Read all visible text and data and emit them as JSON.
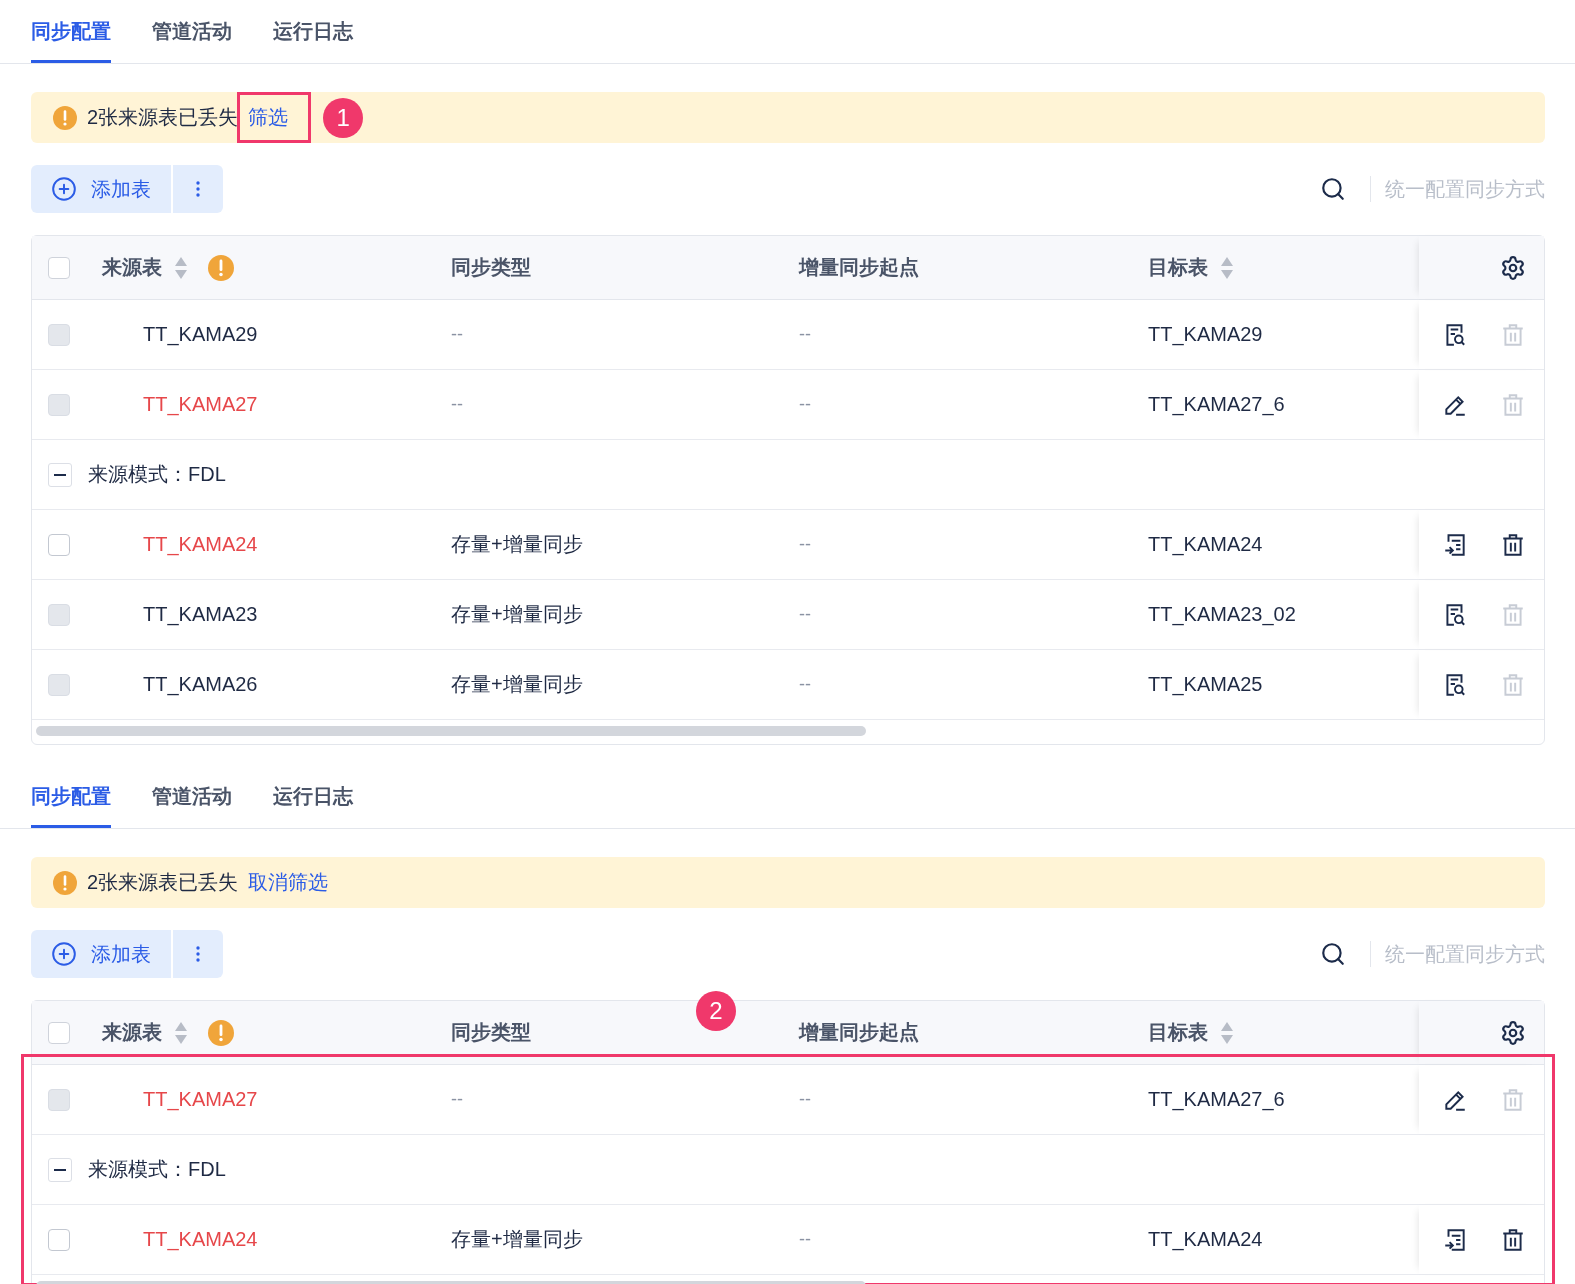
{
  "panels": [
    {
      "tabs": [
        {
          "label": "同步配置",
          "selected": true
        },
        {
          "label": "管道活动",
          "selected": false
        },
        {
          "label": "运行日志",
          "selected": false
        }
      ],
      "alert": {
        "message": "2张来源表已丢失",
        "action": "筛选",
        "action_highlighted": true,
        "badge": "1"
      },
      "toolbar": {
        "add_label": "添加表",
        "batch_label": "统一配置同步方式"
      },
      "table": {
        "highlighted": false,
        "all_selected": false,
        "columns": [
          {
            "label": "来源表",
            "sortable": true,
            "warning": true
          },
          {
            "label": "同步类型",
            "sortable": false,
            "warning": false
          },
          {
            "label": "增量同步起点",
            "sortable": false,
            "warning": false
          },
          {
            "label": "目标表",
            "sortable": true,
            "warning": false
          }
        ],
        "rows": [
          {
            "kind": "table",
            "source": "TT_KAMA29",
            "missing": false,
            "disabled": true,
            "sync_type": "--",
            "start": "--",
            "target": "TT_KAMA29",
            "action": {
              "kind": "view"
            },
            "deletable": false
          },
          {
            "kind": "table",
            "source": "TT_KAMA27",
            "missing": true,
            "disabled": true,
            "sync_type": "--",
            "start": "--",
            "target": "TT_KAMA27_6",
            "action": {
              "kind": "edit"
            },
            "deletable": false
          },
          {
            "kind": "group",
            "label": "来源模式：FDL",
            "expanded": true
          },
          {
            "kind": "table",
            "source": "TT_KAMA24",
            "missing": true,
            "disabled": false,
            "sync_type": "存量+增量同步",
            "start": "--",
            "target": "TT_KAMA24",
            "action": {
              "kind": "map"
            },
            "deletable": true
          },
          {
            "kind": "table",
            "source": "TT_KAMA23",
            "missing": false,
            "disabled": true,
            "sync_type": "存量+增量同步",
            "start": "--",
            "target": "TT_KAMA23_02",
            "action": {
              "kind": "view"
            },
            "deletable": false
          },
          {
            "kind": "table",
            "source": "TT_KAMA26",
            "missing": false,
            "disabled": true,
            "sync_type": "存量+增量同步",
            "start": "--",
            "target": "TT_KAMA25",
            "action": {
              "kind": "view"
            },
            "deletable": false
          }
        ]
      }
    },
    {
      "tabs": [
        {
          "label": "同步配置",
          "selected": true
        },
        {
          "label": "管道活动",
          "selected": false
        },
        {
          "label": "运行日志",
          "selected": false
        }
      ],
      "alert": {
        "message": "2张来源表已丢失",
        "action": "取消筛选",
        "action_highlighted": false
      },
      "toolbar": {
        "add_label": "添加表",
        "batch_label": "统一配置同步方式"
      },
      "table": {
        "highlighted": true,
        "all_selected": false,
        "badge": "2",
        "columns": [
          {
            "label": "来源表",
            "sortable": true,
            "warning": true
          },
          {
            "label": "同步类型",
            "sortable": false,
            "warning": false
          },
          {
            "label": "增量同步起点",
            "sortable": false,
            "warning": false
          },
          {
            "label": "目标表",
            "sortable": true,
            "warning": false
          }
        ],
        "rows": [
          {
            "kind": "table",
            "source": "TT_KAMA27",
            "missing": true,
            "disabled": true,
            "sync_type": "--",
            "start": "--",
            "target": "TT_KAMA27_6",
            "action": {
              "kind": "edit"
            },
            "deletable": false
          },
          {
            "kind": "group",
            "label": "来源模式：FDL",
            "expanded": true
          },
          {
            "kind": "table",
            "source": "TT_KAMA24",
            "missing": true,
            "disabled": false,
            "sync_type": "存量+增量同步",
            "start": "--",
            "target": "TT_KAMA24",
            "action": {
              "kind": "map"
            },
            "deletable": true
          }
        ]
      }
    }
  ]
}
